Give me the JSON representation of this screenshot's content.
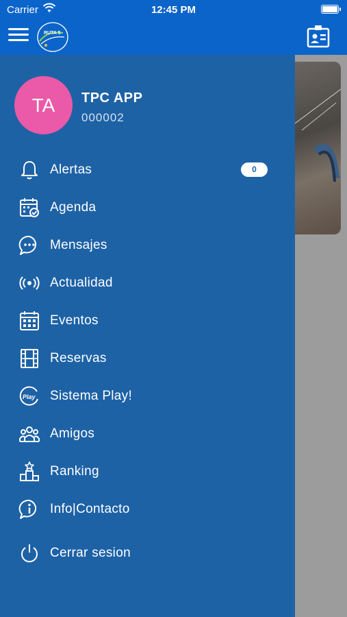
{
  "status_bar": {
    "carrier": "Carrier",
    "time": "12:45 PM"
  },
  "app_bar": {
    "logo_text": "RUTA 5"
  },
  "user": {
    "initials": "TA",
    "name": "TPC APP",
    "id": "000002"
  },
  "menu": {
    "items": [
      {
        "label": "Alertas",
        "icon": "bell-icon",
        "badge": "0"
      },
      {
        "label": "Agenda",
        "icon": "calendar-check-icon"
      },
      {
        "label": "Mensajes",
        "icon": "chat-bubble-icon"
      },
      {
        "label": "Actualidad",
        "icon": "broadcast-icon"
      },
      {
        "label": "Eventos",
        "icon": "calendar-grid-icon"
      },
      {
        "label": "Reservas",
        "icon": "film-icon"
      },
      {
        "label": "Sistema Play!",
        "icon": "play-badge-icon"
      },
      {
        "label": "Amigos",
        "icon": "group-icon"
      },
      {
        "label": "Ranking",
        "icon": "podium-icon"
      },
      {
        "label": "Info|Contacto",
        "icon": "info-bubble-icon"
      },
      {
        "label": "Cerrar sesion",
        "icon": "power-icon"
      }
    ]
  },
  "colors": {
    "app_bar": "#0b64c9",
    "drawer": "#1e62a6",
    "avatar": "#ea5aa8",
    "overlay": "#9c9c9c"
  }
}
